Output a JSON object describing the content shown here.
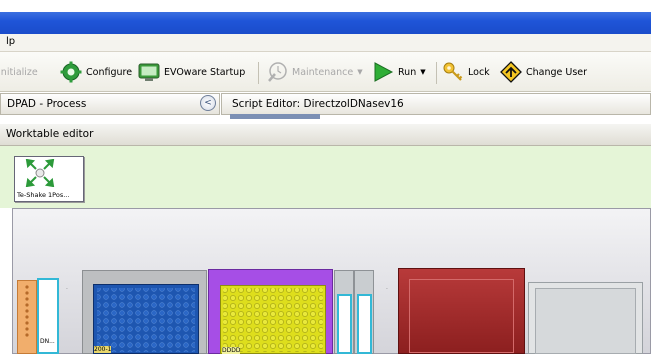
{
  "menu": {
    "item": "lp"
  },
  "toolbar": {
    "initialize": "Initialize",
    "configure": "Configure",
    "evoware_startup": "EVOware Startup",
    "maintenance": "Maintenance",
    "run": "Run",
    "lock": "Lock",
    "change_user": "Change User"
  },
  "panels": {
    "process_title": "DPAD - Process",
    "script_editor_title": "Script Editor: DirectzolDNasev16",
    "worktable_title": "Worktable editor"
  },
  "worktable": {
    "device_label": "Te-Shake 1Pos...",
    "carrier_labels": [
      "DN...",
      "200-1",
      "DDDD"
    ]
  },
  "colors": {
    "title_bar": "#1f55d8",
    "worktable_bg": "#e5f5d7",
    "plate_blue": "#1e56b0",
    "plate_yellow": "#dede1c",
    "carrier_purple": "#a64ee6",
    "block_red": "#a52525",
    "tube_orange": "#f1ae6c"
  }
}
